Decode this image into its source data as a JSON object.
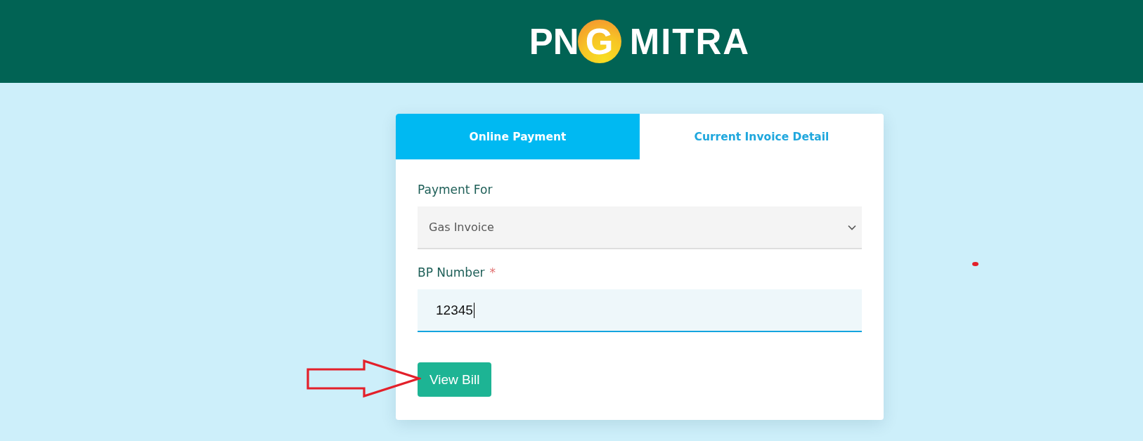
{
  "header": {
    "logo": {
      "lead": "PN",
      "badge_letter": "G",
      "tail": "MITRA"
    }
  },
  "tabs": [
    {
      "label": "Online Payment",
      "selected": true
    },
    {
      "label": "Current Invoice Detail",
      "selected": false
    }
  ],
  "form": {
    "fields": [
      {
        "kind": "select",
        "label": "Payment For",
        "value": "Gas Invoice"
      },
      {
        "kind": "text",
        "label": "BP Number",
        "required_mark": "*",
        "value": "12345",
        "focused": true
      }
    ],
    "submit": {
      "label": "View Bill"
    }
  }
}
